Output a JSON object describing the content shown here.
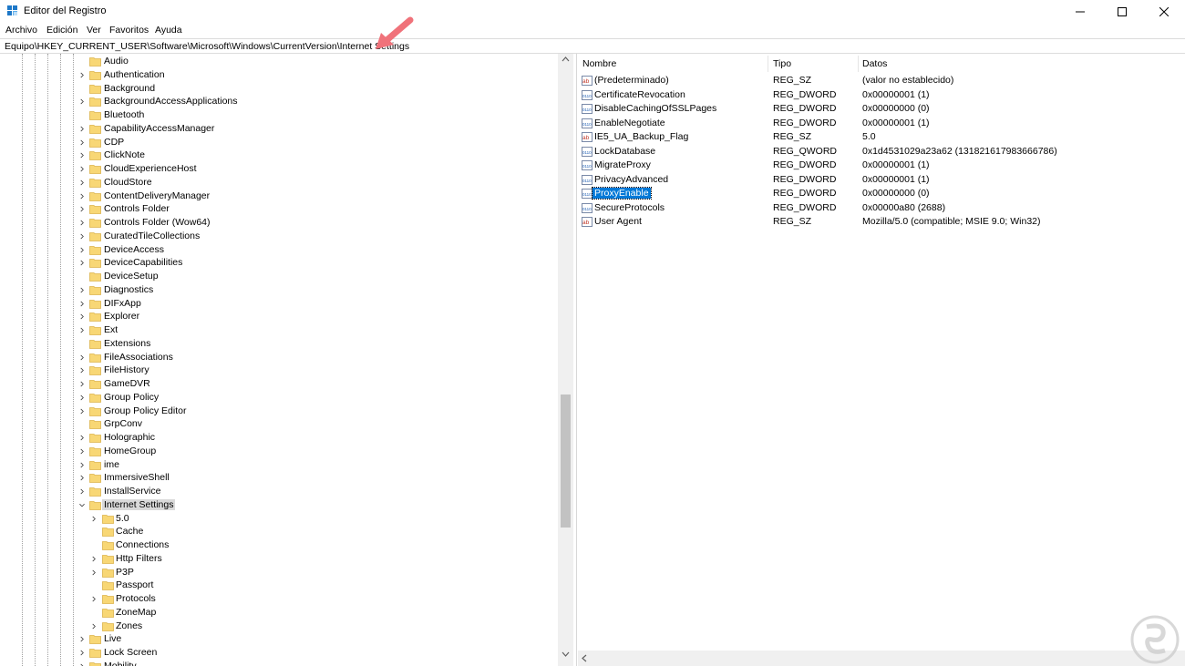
{
  "window": {
    "title": "Editor del Registro"
  },
  "menu": [
    "Archivo",
    "Edición",
    "Ver",
    "Favoritos",
    "Ayuda"
  ],
  "address": "Equipo\\HKEY_CURRENT_USER\\Software\\Microsoft\\Windows\\CurrentVersion\\Internet Settings",
  "tree": [
    {
      "label": "Audio",
      "level": 1,
      "expand": "none"
    },
    {
      "label": "Authentication",
      "level": 1,
      "expand": "collapsed"
    },
    {
      "label": "Background",
      "level": 1,
      "expand": "none"
    },
    {
      "label": "BackgroundAccessApplications",
      "level": 1,
      "expand": "collapsed"
    },
    {
      "label": "Bluetooth",
      "level": 1,
      "expand": "none"
    },
    {
      "label": "CapabilityAccessManager",
      "level": 1,
      "expand": "collapsed"
    },
    {
      "label": "CDP",
      "level": 1,
      "expand": "collapsed"
    },
    {
      "label": "ClickNote",
      "level": 1,
      "expand": "collapsed"
    },
    {
      "label": "CloudExperienceHost",
      "level": 1,
      "expand": "collapsed"
    },
    {
      "label": "CloudStore",
      "level": 1,
      "expand": "collapsed"
    },
    {
      "label": "ContentDeliveryManager",
      "level": 1,
      "expand": "collapsed"
    },
    {
      "label": "Controls Folder",
      "level": 1,
      "expand": "collapsed"
    },
    {
      "label": "Controls Folder (Wow64)",
      "level": 1,
      "expand": "collapsed"
    },
    {
      "label": "CuratedTileCollections",
      "level": 1,
      "expand": "collapsed"
    },
    {
      "label": "DeviceAccess",
      "level": 1,
      "expand": "collapsed"
    },
    {
      "label": "DeviceCapabilities",
      "level": 1,
      "expand": "collapsed"
    },
    {
      "label": "DeviceSetup",
      "level": 1,
      "expand": "none"
    },
    {
      "label": "Diagnostics",
      "level": 1,
      "expand": "collapsed"
    },
    {
      "label": "DIFxApp",
      "level": 1,
      "expand": "collapsed"
    },
    {
      "label": "Explorer",
      "level": 1,
      "expand": "collapsed"
    },
    {
      "label": "Ext",
      "level": 1,
      "expand": "collapsed"
    },
    {
      "label": "Extensions",
      "level": 1,
      "expand": "none"
    },
    {
      "label": "FileAssociations",
      "level": 1,
      "expand": "collapsed"
    },
    {
      "label": "FileHistory",
      "level": 1,
      "expand": "collapsed"
    },
    {
      "label": "GameDVR",
      "level": 1,
      "expand": "collapsed"
    },
    {
      "label": "Group Policy",
      "level": 1,
      "expand": "collapsed"
    },
    {
      "label": "Group Policy Editor",
      "level": 1,
      "expand": "collapsed"
    },
    {
      "label": "GrpConv",
      "level": 1,
      "expand": "none"
    },
    {
      "label": "Holographic",
      "level": 1,
      "expand": "collapsed"
    },
    {
      "label": "HomeGroup",
      "level": 1,
      "expand": "collapsed"
    },
    {
      "label": "ime",
      "level": 1,
      "expand": "collapsed"
    },
    {
      "label": "ImmersiveShell",
      "level": 1,
      "expand": "collapsed"
    },
    {
      "label": "InstallService",
      "level": 1,
      "expand": "collapsed"
    },
    {
      "label": "Internet Settings",
      "level": 1,
      "expand": "expanded",
      "selected": true
    },
    {
      "label": "5.0",
      "level": 2,
      "expand": "collapsed"
    },
    {
      "label": "Cache",
      "level": 2,
      "expand": "none"
    },
    {
      "label": "Connections",
      "level": 2,
      "expand": "none"
    },
    {
      "label": "Http Filters",
      "level": 2,
      "expand": "collapsed"
    },
    {
      "label": "P3P",
      "level": 2,
      "expand": "collapsed"
    },
    {
      "label": "Passport",
      "level": 2,
      "expand": "none"
    },
    {
      "label": "Protocols",
      "level": 2,
      "expand": "collapsed"
    },
    {
      "label": "ZoneMap",
      "level": 2,
      "expand": "none"
    },
    {
      "label": "Zones",
      "level": 2,
      "expand": "collapsed"
    },
    {
      "label": "Live",
      "level": 1,
      "expand": "collapsed"
    },
    {
      "label": "Lock Screen",
      "level": 1,
      "expand": "collapsed"
    },
    {
      "label": "Mobility",
      "level": 1,
      "expand": "collapsed"
    }
  ],
  "columns": {
    "name": "Nombre",
    "type": "Tipo",
    "data": "Datos"
  },
  "values": [
    {
      "name": "(Predeterminado)",
      "type": "REG_SZ",
      "data": "(valor no establecido)",
      "icon": "string-value-icon"
    },
    {
      "name": "CertificateRevocation",
      "type": "REG_DWORD",
      "data": "0x00000001 (1)",
      "icon": "binary-value-icon"
    },
    {
      "name": "DisableCachingOfSSLPages",
      "type": "REG_DWORD",
      "data": "0x00000000 (0)",
      "icon": "binary-value-icon"
    },
    {
      "name": "EnableNegotiate",
      "type": "REG_DWORD",
      "data": "0x00000001 (1)",
      "icon": "binary-value-icon"
    },
    {
      "name": "IE5_UA_Backup_Flag",
      "type": "REG_SZ",
      "data": "5.0",
      "icon": "string-value-icon"
    },
    {
      "name": "LockDatabase",
      "type": "REG_QWORD",
      "data": "0x1d4531029a23a62 (131821617983666786)",
      "icon": "binary-value-icon"
    },
    {
      "name": "MigrateProxy",
      "type": "REG_DWORD",
      "data": "0x00000001 (1)",
      "icon": "binary-value-icon"
    },
    {
      "name": "PrivacyAdvanced",
      "type": "REG_DWORD",
      "data": "0x00000001 (1)",
      "icon": "binary-value-icon"
    },
    {
      "name": "ProxyEnable",
      "type": "REG_DWORD",
      "data": "0x00000000 (0)",
      "icon": "binary-value-icon",
      "selected": true
    },
    {
      "name": "SecureProtocols",
      "type": "REG_DWORD",
      "data": "0x00000a80 (2688)",
      "icon": "binary-value-icon"
    },
    {
      "name": "User Agent",
      "type": "REG_SZ",
      "data": "Mozilla/5.0 (compatible; MSIE 9.0; Win32)",
      "icon": "string-value-icon"
    }
  ],
  "colors": {
    "accent": "#0078d7",
    "folder": "#f8d775",
    "arrow": "#f0727a"
  }
}
